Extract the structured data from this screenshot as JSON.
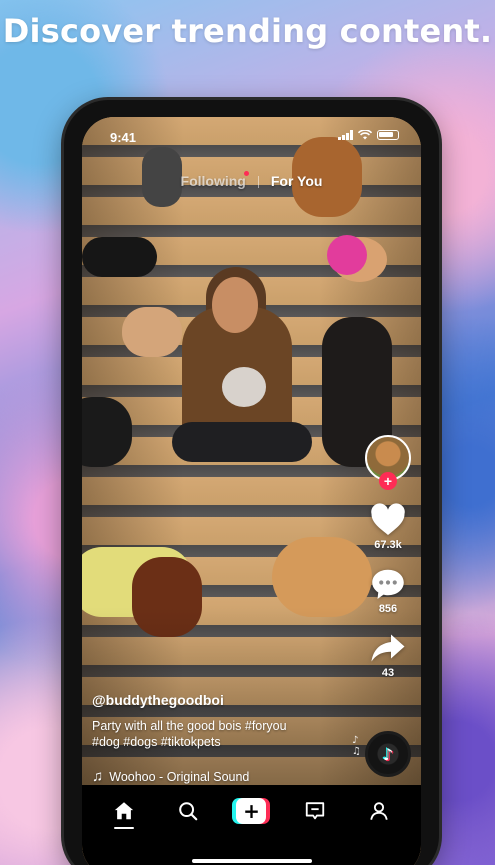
{
  "headline": "Discover trending content.",
  "status_bar": {
    "time": "9:41"
  },
  "feed_tabs": {
    "following": "Following",
    "for_you": "For You",
    "active": "For You"
  },
  "side_actions": {
    "like_count": "67.3k",
    "comment_count": "856",
    "share_count": "43"
  },
  "post": {
    "username": "@buddythegoodboi",
    "description_line1": "Party with all the good bois #foryou",
    "description_line2": "#dog #dogs #tiktokpets",
    "sound": "Woohoo - Original Sound"
  },
  "bottom_nav": {
    "items": [
      "home",
      "discover",
      "create",
      "inbox",
      "profile"
    ],
    "active": "home"
  },
  "colors": {
    "accent_red": "#fe2c55",
    "accent_cyan": "#25f4ee"
  }
}
